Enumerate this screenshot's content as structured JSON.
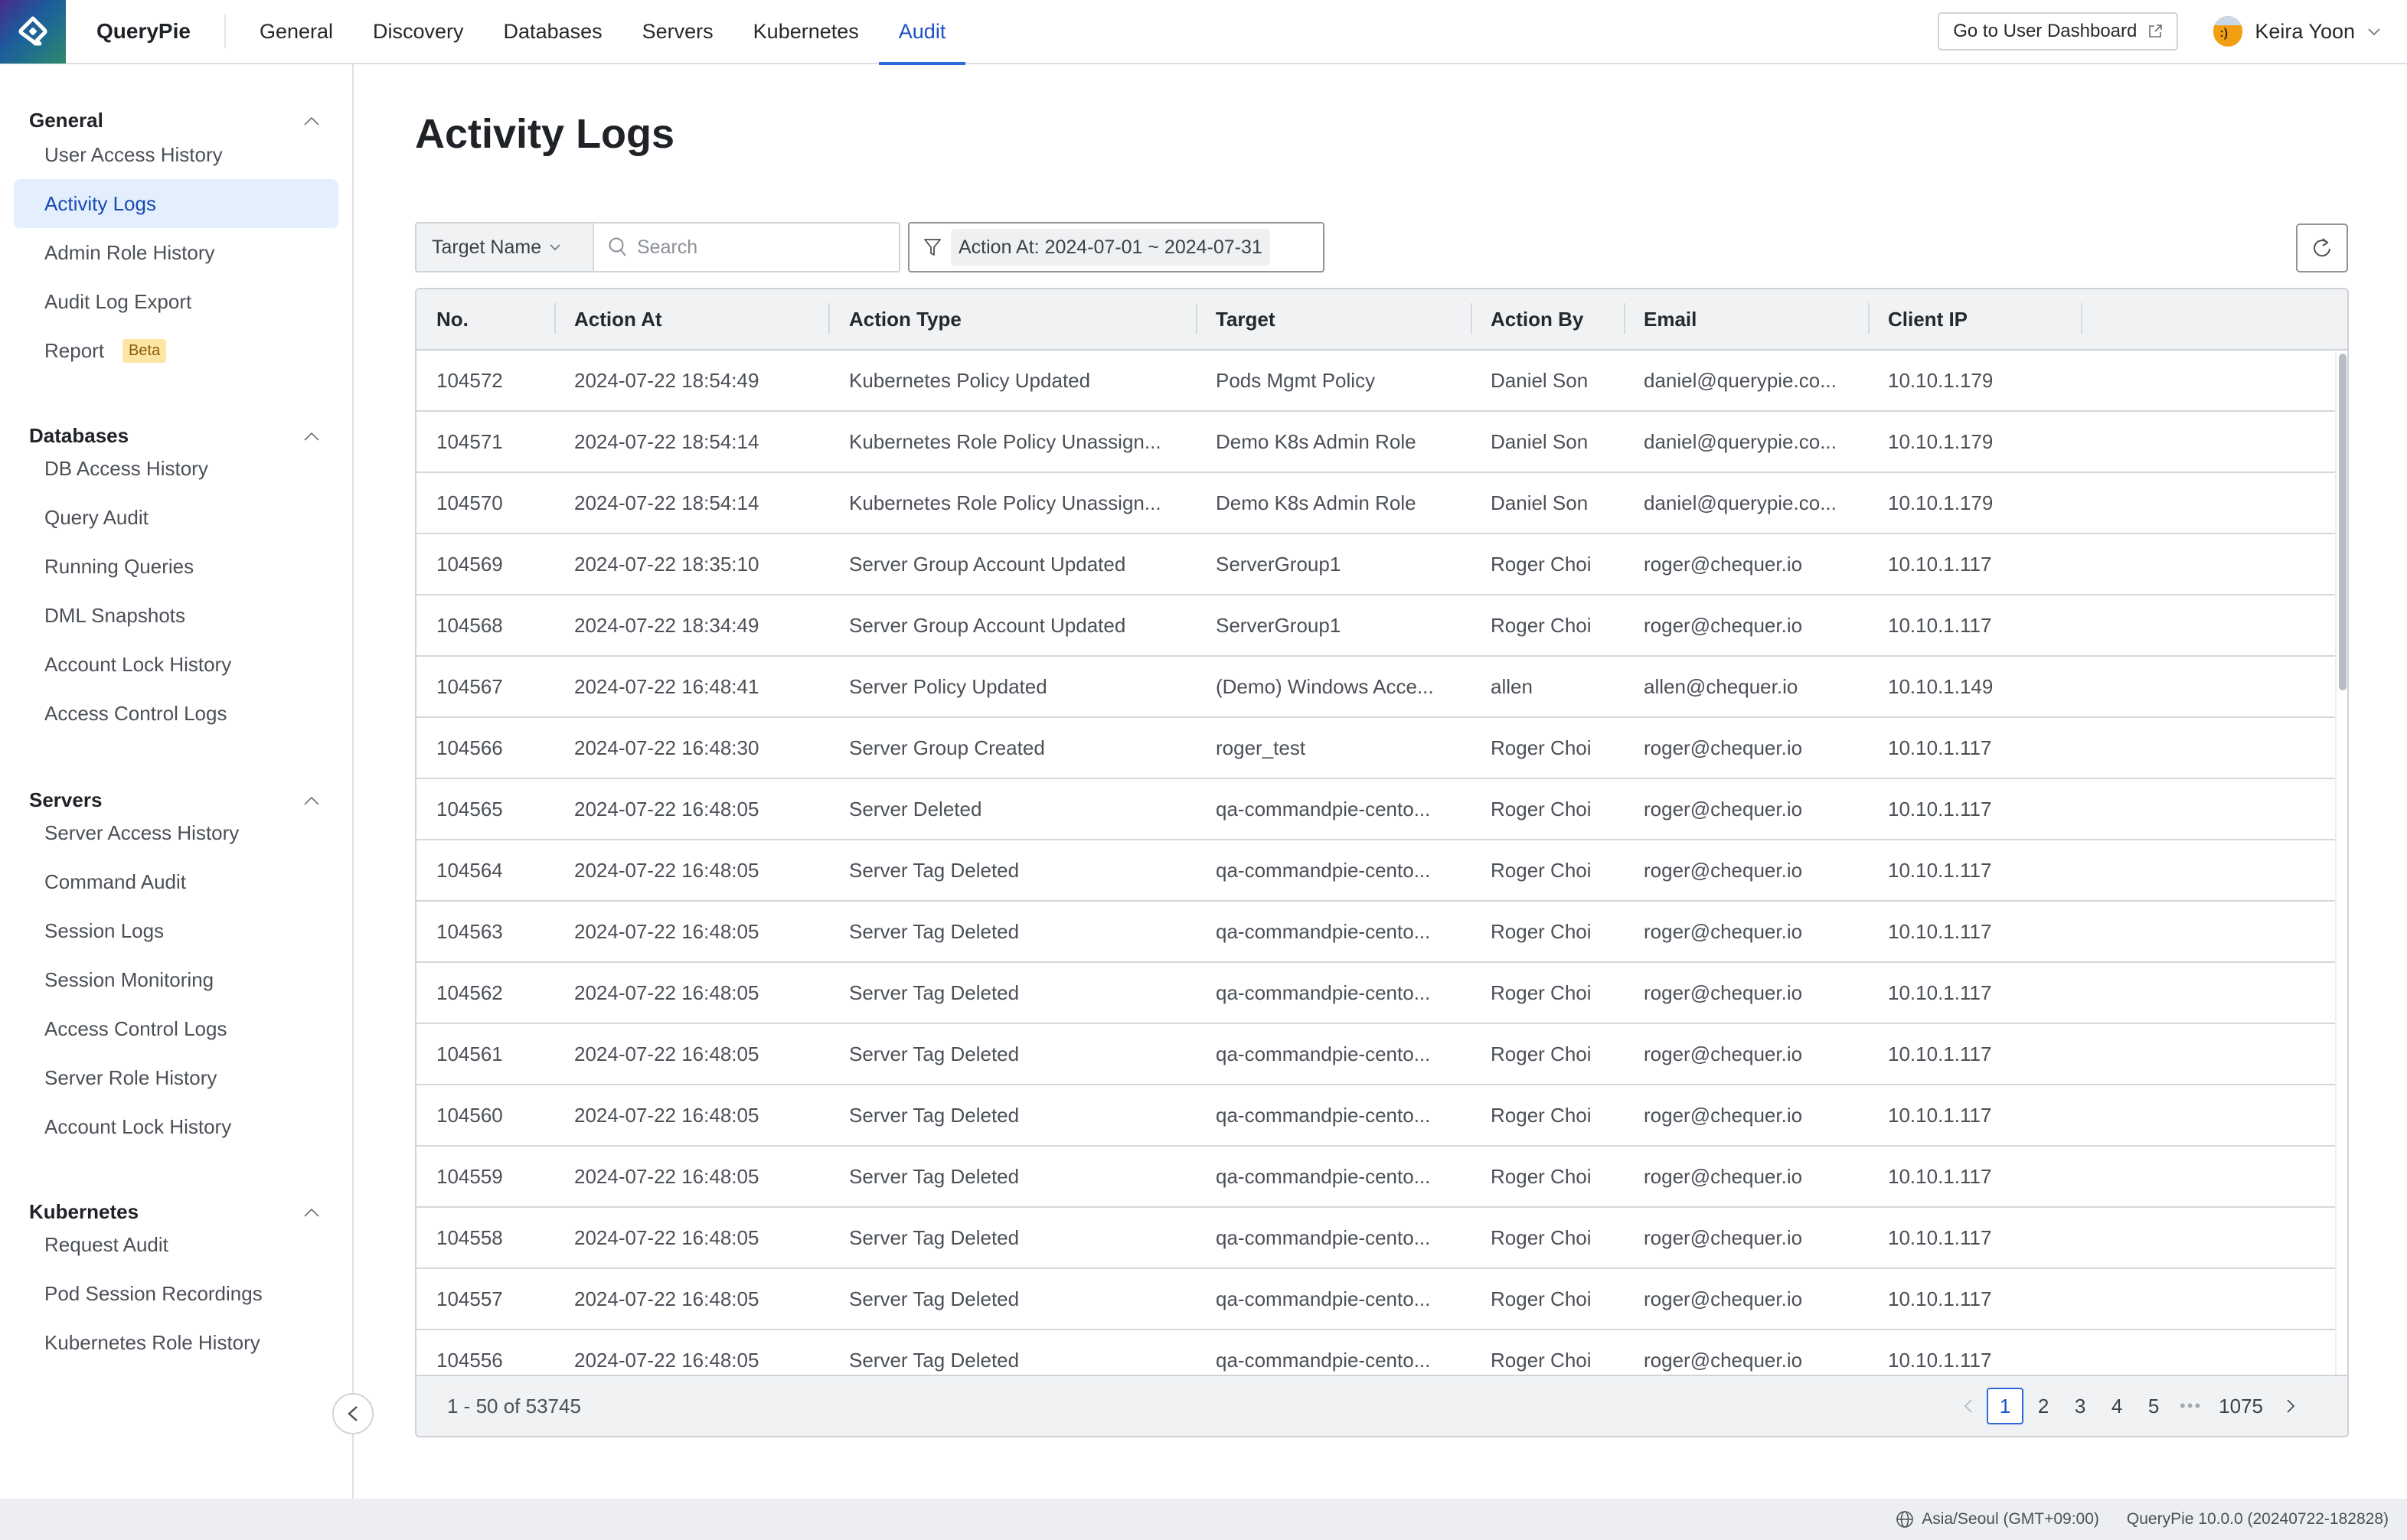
{
  "app": {
    "brand": "QueryPie",
    "nav_tabs": [
      {
        "label": "General",
        "active": false
      },
      {
        "label": "Discovery",
        "active": false
      },
      {
        "label": "Databases",
        "active": false
      },
      {
        "label": "Servers",
        "active": false
      },
      {
        "label": "Kubernetes",
        "active": false
      },
      {
        "label": "Audit",
        "active": true
      }
    ],
    "dashboard_button": "Go to User Dashboard",
    "user_name": "Keira Yoon"
  },
  "sidebar": {
    "sections": [
      {
        "title": "General",
        "items": [
          {
            "label": "User Access History"
          },
          {
            "label": "Activity Logs",
            "active": true
          },
          {
            "label": "Admin Role History"
          },
          {
            "label": "Audit Log Export"
          },
          {
            "label": "Report",
            "badge": "Beta"
          }
        ]
      },
      {
        "title": "Databases",
        "items": [
          {
            "label": "DB Access History"
          },
          {
            "label": "Query Audit"
          },
          {
            "label": "Running Queries"
          },
          {
            "label": "DML Snapshots"
          },
          {
            "label": "Account Lock History"
          },
          {
            "label": "Access Control Logs"
          }
        ]
      },
      {
        "title": "Servers",
        "items": [
          {
            "label": "Server Access History"
          },
          {
            "label": "Command Audit"
          },
          {
            "label": "Session Logs"
          },
          {
            "label": "Session Monitoring"
          },
          {
            "label": "Access Control Logs"
          },
          {
            "label": "Server Role History"
          },
          {
            "label": "Account Lock History"
          }
        ]
      },
      {
        "title": "Kubernetes",
        "items": [
          {
            "label": "Request Audit"
          },
          {
            "label": "Pod Session Recordings"
          },
          {
            "label": "Kubernetes Role History"
          }
        ]
      }
    ]
  },
  "main": {
    "title": "Activity Logs",
    "filter": {
      "target_select": "Target Name",
      "search_placeholder": "Search",
      "search_value": "",
      "date_filter": "Action At: 2024-07-01 ~ 2024-07-31"
    },
    "table": {
      "columns": [
        "No.",
        "Action At",
        "Action Type",
        "Target",
        "Action By",
        "Email",
        "Client IP"
      ],
      "rows": [
        [
          "104572",
          "2024-07-22 18:54:49",
          "Kubernetes Policy Updated",
          "Pods Mgmt Policy",
          "Daniel Son",
          "daniel@querypie.co...",
          "10.10.1.179"
        ],
        [
          "104571",
          "2024-07-22 18:54:14",
          "Kubernetes Role Policy Unassign...",
          "Demo K8s Admin Role",
          "Daniel Son",
          "daniel@querypie.co...",
          "10.10.1.179"
        ],
        [
          "104570",
          "2024-07-22 18:54:14",
          "Kubernetes Role Policy Unassign...",
          "Demo K8s Admin Role",
          "Daniel Son",
          "daniel@querypie.co...",
          "10.10.1.179"
        ],
        [
          "104569",
          "2024-07-22 18:35:10",
          "Server Group Account Updated",
          "ServerGroup1",
          "Roger Choi",
          "roger@chequer.io",
          "10.10.1.117"
        ],
        [
          "104568",
          "2024-07-22 18:34:49",
          "Server Group Account Updated",
          "ServerGroup1",
          "Roger Choi",
          "roger@chequer.io",
          "10.10.1.117"
        ],
        [
          "104567",
          "2024-07-22 16:48:41",
          "Server Policy Updated",
          "(Demo) Windows Acce...",
          "allen",
          "allen@chequer.io",
          "10.10.1.149"
        ],
        [
          "104566",
          "2024-07-22 16:48:30",
          "Server Group Created",
          "roger_test",
          "Roger Choi",
          "roger@chequer.io",
          "10.10.1.117"
        ],
        [
          "104565",
          "2024-07-22 16:48:05",
          "Server Deleted",
          "qa-commandpie-cento...",
          "Roger Choi",
          "roger@chequer.io",
          "10.10.1.117"
        ],
        [
          "104564",
          "2024-07-22 16:48:05",
          "Server Tag Deleted",
          "qa-commandpie-cento...",
          "Roger Choi",
          "roger@chequer.io",
          "10.10.1.117"
        ],
        [
          "104563",
          "2024-07-22 16:48:05",
          "Server Tag Deleted",
          "qa-commandpie-cento...",
          "Roger Choi",
          "roger@chequer.io",
          "10.10.1.117"
        ],
        [
          "104562",
          "2024-07-22 16:48:05",
          "Server Tag Deleted",
          "qa-commandpie-cento...",
          "Roger Choi",
          "roger@chequer.io",
          "10.10.1.117"
        ],
        [
          "104561",
          "2024-07-22 16:48:05",
          "Server Tag Deleted",
          "qa-commandpie-cento...",
          "Roger Choi",
          "roger@chequer.io",
          "10.10.1.117"
        ],
        [
          "104560",
          "2024-07-22 16:48:05",
          "Server Tag Deleted",
          "qa-commandpie-cento...",
          "Roger Choi",
          "roger@chequer.io",
          "10.10.1.117"
        ],
        [
          "104559",
          "2024-07-22 16:48:05",
          "Server Tag Deleted",
          "qa-commandpie-cento...",
          "Roger Choi",
          "roger@chequer.io",
          "10.10.1.117"
        ],
        [
          "104558",
          "2024-07-22 16:48:05",
          "Server Tag Deleted",
          "qa-commandpie-cento...",
          "Roger Choi",
          "roger@chequer.io",
          "10.10.1.117"
        ],
        [
          "104557",
          "2024-07-22 16:48:05",
          "Server Tag Deleted",
          "qa-commandpie-cento...",
          "Roger Choi",
          "roger@chequer.io",
          "10.10.1.117"
        ],
        [
          "104556",
          "2024-07-22 16:48:05",
          "Server Tag Deleted",
          "qa-commandpie-cento...",
          "Roger Choi",
          "roger@chequer.io",
          "10.10.1.117"
        ]
      ]
    },
    "pagination": {
      "range_text": "1 - 50 of 53745",
      "pages": [
        "1",
        "2",
        "3",
        "4",
        "5"
      ],
      "current": "1",
      "last_page": "1075"
    }
  },
  "statusbar": {
    "timezone": "Asia/Seoul (GMT+09:00)",
    "version": "QueryPie 10.0.0 (20240722-182828)"
  },
  "colors": {
    "accent": "#2e6ad8",
    "active_nav_text": "#1b51c2",
    "active_sidebar_bg": "#e3effd",
    "beta_badge_bg": "#fde6a4"
  }
}
